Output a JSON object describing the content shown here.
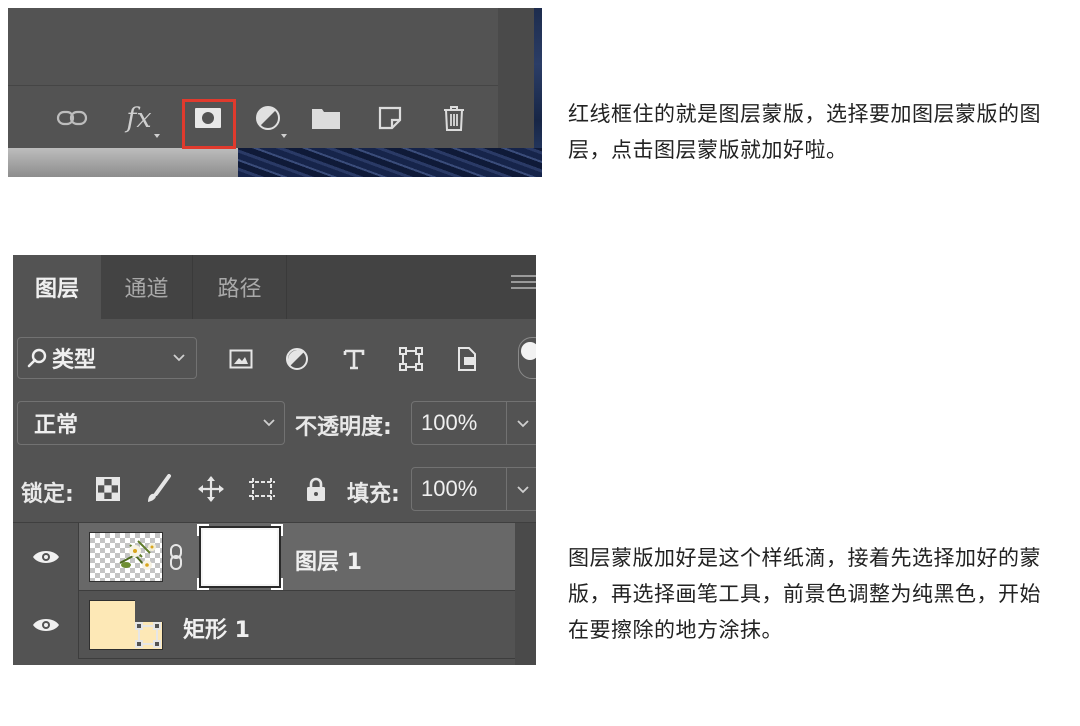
{
  "panel1": {
    "footer_buttons": [
      {
        "name": "link-layers",
        "icon": "link-icon"
      },
      {
        "name": "layer-style",
        "icon": "fx-icon",
        "label": "fx"
      },
      {
        "name": "add-mask",
        "icon": "mask-icon"
      },
      {
        "name": "adjustment-layer",
        "icon": "half-circle-icon"
      },
      {
        "name": "new-group",
        "icon": "folder-icon"
      },
      {
        "name": "new-layer",
        "icon": "new-layer-icon"
      },
      {
        "name": "delete-layer",
        "icon": "trash-icon"
      }
    ],
    "highlight_color": "#e03a2d"
  },
  "captions": {
    "caption1": "红线框住的就是图层蒙版，选择要加图层蒙版的图层，点击图层蒙版就加好啦。",
    "caption2": "图层蒙版加好是这个样纸滴，接着先选择加好的蒙版，再选择画笔工具，前景色调整为纯黑色，开始在要擦除的地方涂抹。"
  },
  "layers_panel": {
    "tabs": [
      {
        "label": "图层",
        "active": true
      },
      {
        "label": "通道",
        "active": false
      },
      {
        "label": "路径",
        "active": false
      }
    ],
    "filter": {
      "kind_label": "类型",
      "icons": [
        "image-filter-icon",
        "adjustment-filter-icon",
        "type-filter-icon",
        "shape-filter-icon",
        "smart-object-filter-icon"
      ]
    },
    "blend_mode": "正常",
    "opacity_label": "不透明度:",
    "opacity_value": "100%",
    "lock_label": "锁定:",
    "fill_label": "填充:",
    "fill_value": "100%",
    "layers": [
      {
        "name": "图层 1",
        "visible": true,
        "selected": true,
        "has_mask": true
      },
      {
        "name": "矩形 1",
        "visible": true,
        "selected": false,
        "has_mask": false,
        "type": "shape"
      }
    ],
    "colors": {
      "panel_bg": "#535353",
      "tab_bar_bg": "#434343",
      "selected_row_bg": "#686868",
      "shape_thumb": "#fde8b6"
    }
  }
}
